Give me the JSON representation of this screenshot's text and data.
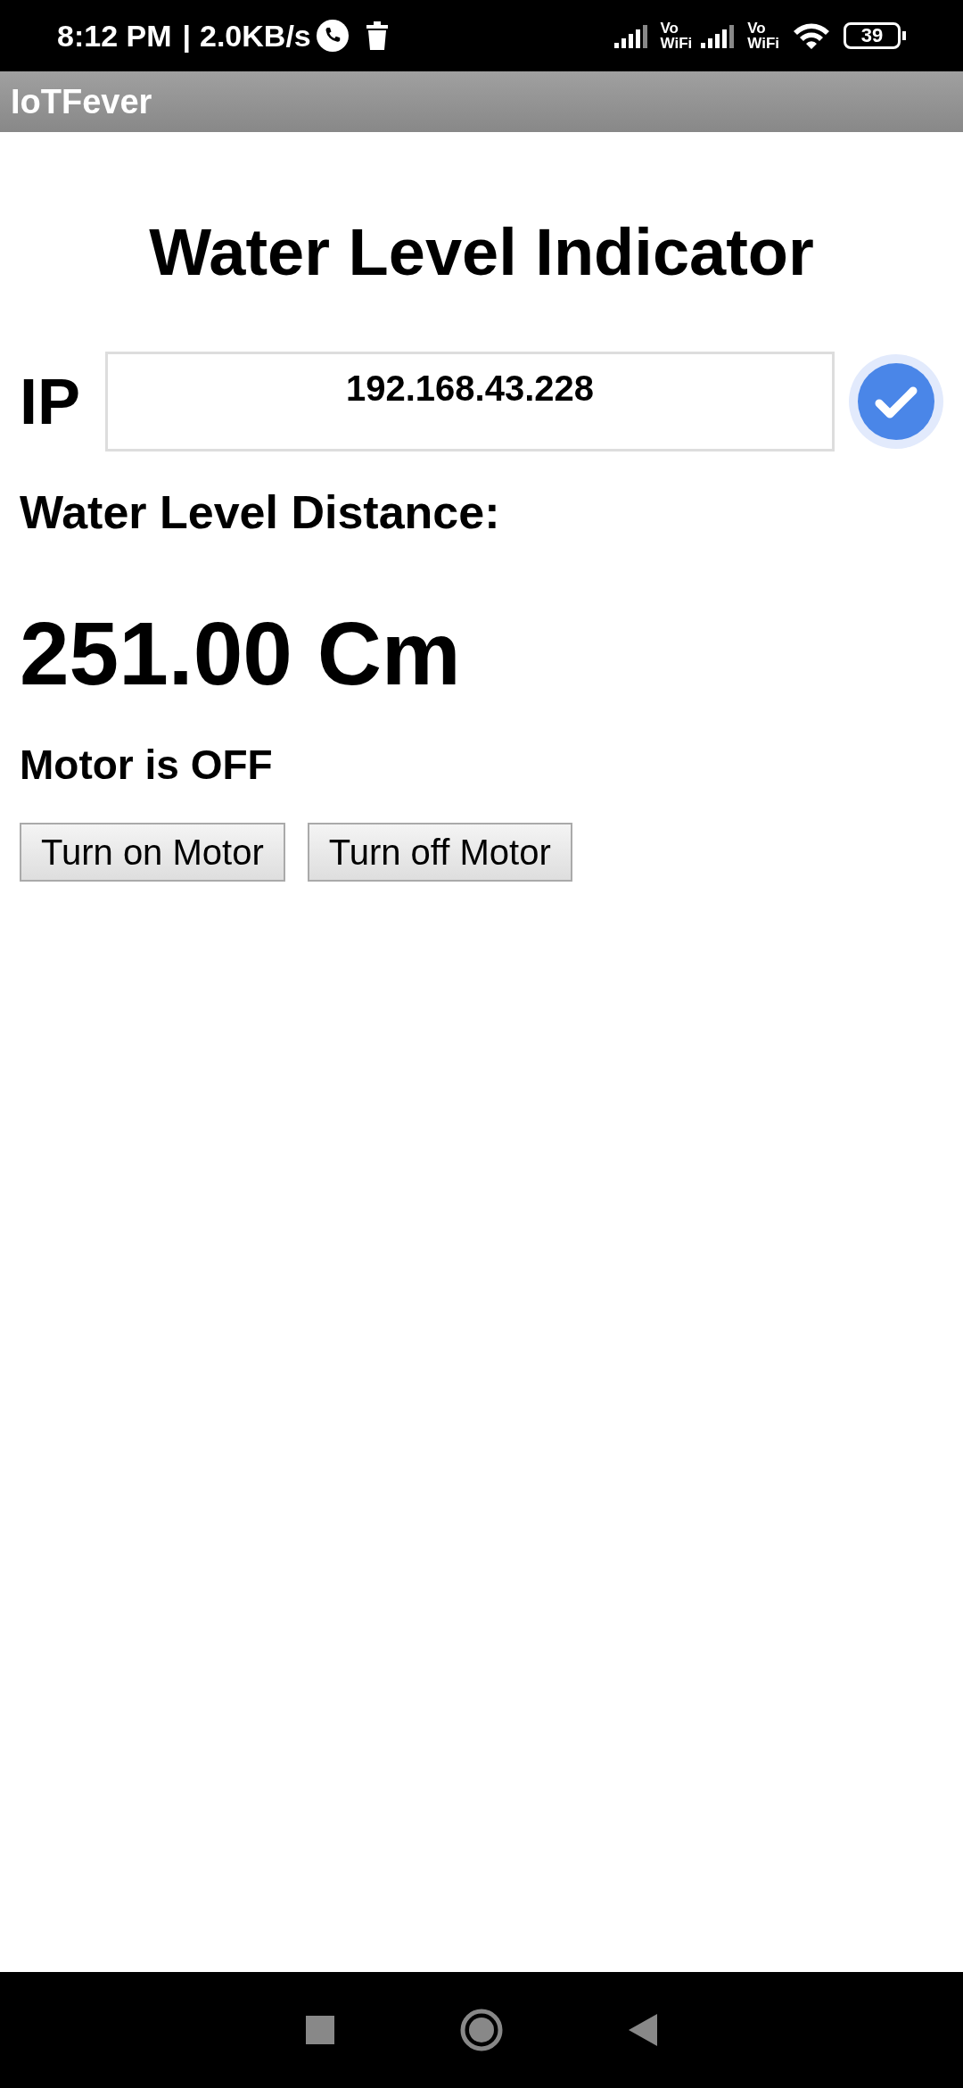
{
  "status_bar": {
    "time": "8:12 PM",
    "speed": "2.0KB/s",
    "separator": "|",
    "battery": "39",
    "vo_wifi": [
      "Vo",
      "WiFi",
      "Vo",
      "WiFi"
    ]
  },
  "app_bar": {
    "title": "IoTFever"
  },
  "page": {
    "title": "Water Level Indicator",
    "ip_label": "IP",
    "ip_field": {
      "value": "192.168.43.228"
    },
    "distance_label": "Water Level Distance:",
    "distance_value": "251.00 Cm",
    "motor_status": "Motor is OFF",
    "buttons": [
      "Turn on Motor",
      "Turn off Motor"
    ]
  }
}
